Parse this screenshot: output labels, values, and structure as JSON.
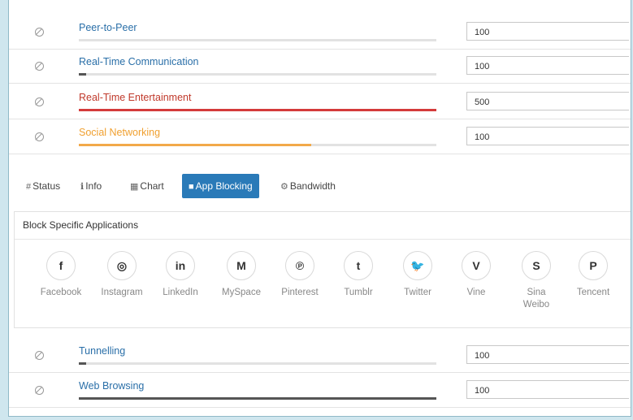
{
  "categories_top": [
    {
      "name": "Peer-to-Peer",
      "name_color": "#2a6fa8",
      "bar_color": "#e2e2e2",
      "bar_fill": 0.0,
      "limit": "100"
    },
    {
      "name": "Real-Time Communication",
      "name_color": "#2a6fa8",
      "bar_color": "#555555",
      "bar_fill": 0.02,
      "limit": "100"
    },
    {
      "name": "Real-Time Entertainment",
      "name_color": "#c0392b",
      "bar_color": "#d43b3b",
      "bar_fill": 1.0,
      "limit": "500"
    },
    {
      "name": "Social Networking",
      "name_color": "#f0a030",
      "bar_color": "#f2a94a",
      "bar_fill": 0.65,
      "limit": "100"
    }
  ],
  "tabs": [
    {
      "icon": "#",
      "label": "Status"
    },
    {
      "icon": "ℹ",
      "label": "Info"
    },
    {
      "icon": "▦",
      "label": "Chart"
    },
    {
      "icon": "■",
      "label": "App Blocking"
    },
    {
      "icon": "⚙",
      "label": "Bandwidth"
    }
  ],
  "panel": {
    "title": "Block Specific Applications",
    "apps": [
      {
        "glyph": "f",
        "label": "Facebook",
        "icon": "facebook-icon"
      },
      {
        "glyph": "◎",
        "label": "Instagram",
        "icon": "instagram-icon"
      },
      {
        "glyph": "in",
        "label": "LinkedIn",
        "icon": "linkedin-icon"
      },
      {
        "glyph": "M",
        "label": "MySpace",
        "icon": "myspace-icon"
      },
      {
        "glyph": "℗",
        "label": "Pinterest",
        "icon": "pinterest-icon"
      },
      {
        "glyph": "t",
        "label": "Tumblr",
        "icon": "tumblr-icon"
      },
      {
        "glyph": "🐦",
        "label": "Twitter",
        "icon": "twitter-icon"
      },
      {
        "glyph": "V",
        "label": "Vine",
        "icon": "vine-icon"
      },
      {
        "glyph": "S",
        "label": "Sina\nWeibo",
        "icon": "sina-weibo-icon"
      },
      {
        "glyph": "P",
        "label": "Tencent",
        "icon": "tencent-icon"
      }
    ]
  },
  "categories_bottom": [
    {
      "name": "Tunnelling",
      "name_color": "#2a6fa8",
      "bar_color": "#555555",
      "bar_fill": 0.02,
      "limit": "100"
    },
    {
      "name": "Web Browsing",
      "name_color": "#2a6fa8",
      "bar_color": "#555555",
      "bar_fill": 1.0,
      "limit": "100"
    }
  ]
}
